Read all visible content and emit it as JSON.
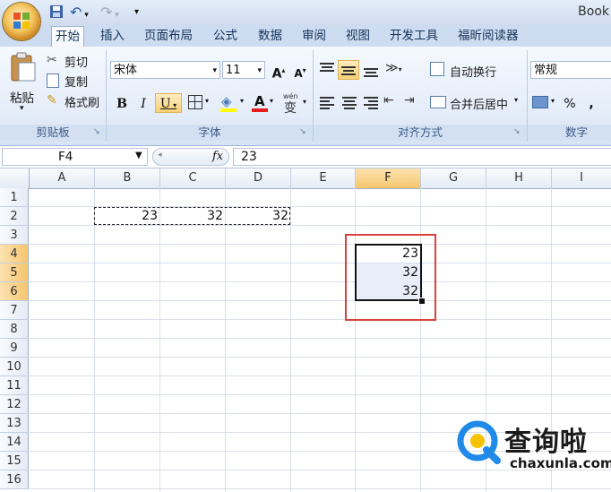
{
  "window": {
    "title": "Book"
  },
  "quick_access": {
    "save": "💾",
    "undo": "↶",
    "redo": "↷",
    "more": "⇌"
  },
  "tabs": [
    "开始",
    "插入",
    "页面布局",
    "公式",
    "数据",
    "审阅",
    "视图",
    "开发工具",
    "福昕阅读器"
  ],
  "ribbon": {
    "clipboard": {
      "paste": "粘贴",
      "cut": "剪切",
      "copy": "复制",
      "format_painter": "格式刷",
      "label": "剪贴板"
    },
    "font": {
      "name": "宋体",
      "size": "11",
      "grow": "A",
      "shrink": "A",
      "bold": "B",
      "italic": "I",
      "underline": "U",
      "font_color_glyph": "A",
      "phonetic": "wén",
      "label": "字体"
    },
    "alignment": {
      "wrap_text": "自动换行",
      "merge_center": "合并后居中",
      "label": "对齐方式"
    },
    "number": {
      "format": "常规",
      "percent": "%",
      "comma": ",",
      "label": "数字"
    }
  },
  "formula_bar": {
    "name_box": "F4",
    "fx": "fx",
    "value": "23"
  },
  "columns": [
    "A",
    "B",
    "C",
    "D",
    "E",
    "F",
    "G",
    "H",
    "I"
  ],
  "rows": [
    "1",
    "2",
    "3",
    "4",
    "5",
    "6",
    "7",
    "8",
    "9",
    "10",
    "11",
    "12",
    "13",
    "14",
    "15",
    "16"
  ],
  "cells": {
    "B2": "23",
    "C2": "32",
    "D2": "32",
    "F4": "23",
    "F5": "32",
    "F6": "32"
  },
  "watermark": {
    "brand": "查询啦",
    "url": "chaxunla.com",
    "colors": {
      "blue": "#1f8ae8",
      "yellow": "#f5c200"
    }
  }
}
